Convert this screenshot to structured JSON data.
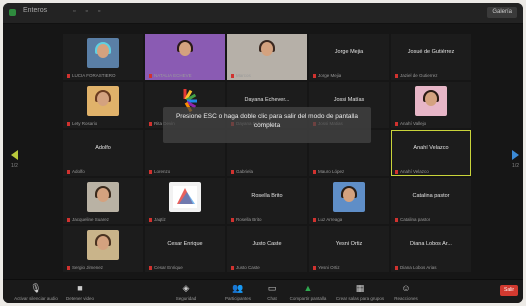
{
  "window": {
    "title": "Enteros"
  },
  "header": {
    "view_label": "Galería"
  },
  "message": {
    "text": "Presione ESC o haga doble clic para salir del modo de pantalla completa"
  },
  "colors": {
    "active_speaker_border": "#c9d43a",
    "leave_button": "#d23a30",
    "muted_icon": "#d0322f",
    "share_screen": "#2fa84f"
  },
  "tiles": [
    {
      "name": "LUCIA FORASTIERO",
      "big": "",
      "photo": "pink-hair-man"
    },
    {
      "name": "NATALIA ECHEVE",
      "big": "",
      "photo": "woman-purple-bg"
    },
    {
      "name": "Marcos",
      "big": "",
      "photo": "woman-smiling"
    },
    {
      "name": "Jorge Mejia",
      "big": "Jorge Mejia",
      "photo": ""
    },
    {
      "name": "Jaziel de Gutierrez",
      "big": "Josué de Gutiérrez",
      "photo": ""
    },
    {
      "name": "Lety Rosario",
      "big": "",
      "photo": "woman-orange"
    },
    {
      "name": "Rita Devin",
      "big": "",
      "photo": "colorful-logo"
    },
    {
      "name": "Dayana Echeverria",
      "big": "Dayana Echever...",
      "photo": ""
    },
    {
      "name": "Jossi Matias",
      "big": "Jossi Matías",
      "photo": ""
    },
    {
      "name": "Anahí Vallejo",
      "big": "",
      "photo": "woman-glasses-pink"
    },
    {
      "name": "Adolfo",
      "big": "Adolfo",
      "photo": ""
    },
    {
      "name": "Lorenzo",
      "big": "",
      "photo": ""
    },
    {
      "name": "Gabriela",
      "big": "",
      "photo": ""
    },
    {
      "name": "Mauro López",
      "big": "",
      "photo": ""
    },
    {
      "name": "Anahí Velazco",
      "big": "Anahí Velazco",
      "photo": "",
      "active": true
    },
    {
      "name": "Jacqueline Suarez",
      "big": "",
      "photo": "man-room"
    },
    {
      "name": "Jaqtiz",
      "big": "",
      "photo": "jaq-logo"
    },
    {
      "name": "Rosella Brito",
      "big": "Rosella Brito",
      "photo": ""
    },
    {
      "name": "Luz Arreaga",
      "big": "",
      "photo": "man-green-shirt"
    },
    {
      "name": "Catalina pastor",
      "big": "Catalina pastor",
      "photo": ""
    },
    {
      "name": "Sergio Jimenez",
      "big": "",
      "photo": "woman-outdoor"
    },
    {
      "name": "Cesar Enrique",
      "big": "Cesar Enrique",
      "photo": ""
    },
    {
      "name": "Justo Caste",
      "big": "Justo Caste",
      "photo": ""
    },
    {
      "name": "Yesni Ortiz",
      "big": "Yesni Ortiz",
      "photo": ""
    },
    {
      "name": "Diana Lobos Arias",
      "big": "Diana Lobos Ar...",
      "photo": ""
    }
  ],
  "toolbar": {
    "items": [
      {
        "icon": "microphone-icon",
        "glyph": "🎙",
        "label": "Activar silenciar audio"
      },
      {
        "icon": "video-icon",
        "glyph": "■",
        "label": "Detener video"
      },
      {
        "icon": "security-icon",
        "glyph": "◈",
        "label": "Seguridad"
      },
      {
        "icon": "participants-icon",
        "glyph": "👥",
        "label": "Participantes"
      },
      {
        "icon": "chat-icon",
        "glyph": "▭",
        "label": "Chat"
      },
      {
        "icon": "share-screen-icon",
        "glyph": "▲",
        "label": "Compartir pantalla"
      },
      {
        "icon": "breakout-rooms-icon",
        "glyph": "▦",
        "label": "Crear salas para grupos"
      },
      {
        "icon": "reactions-icon",
        "glyph": "☺",
        "label": "Reacciones"
      }
    ],
    "end_label": "Salir"
  },
  "pagination": {
    "left": "1/2",
    "right": "1/2"
  }
}
